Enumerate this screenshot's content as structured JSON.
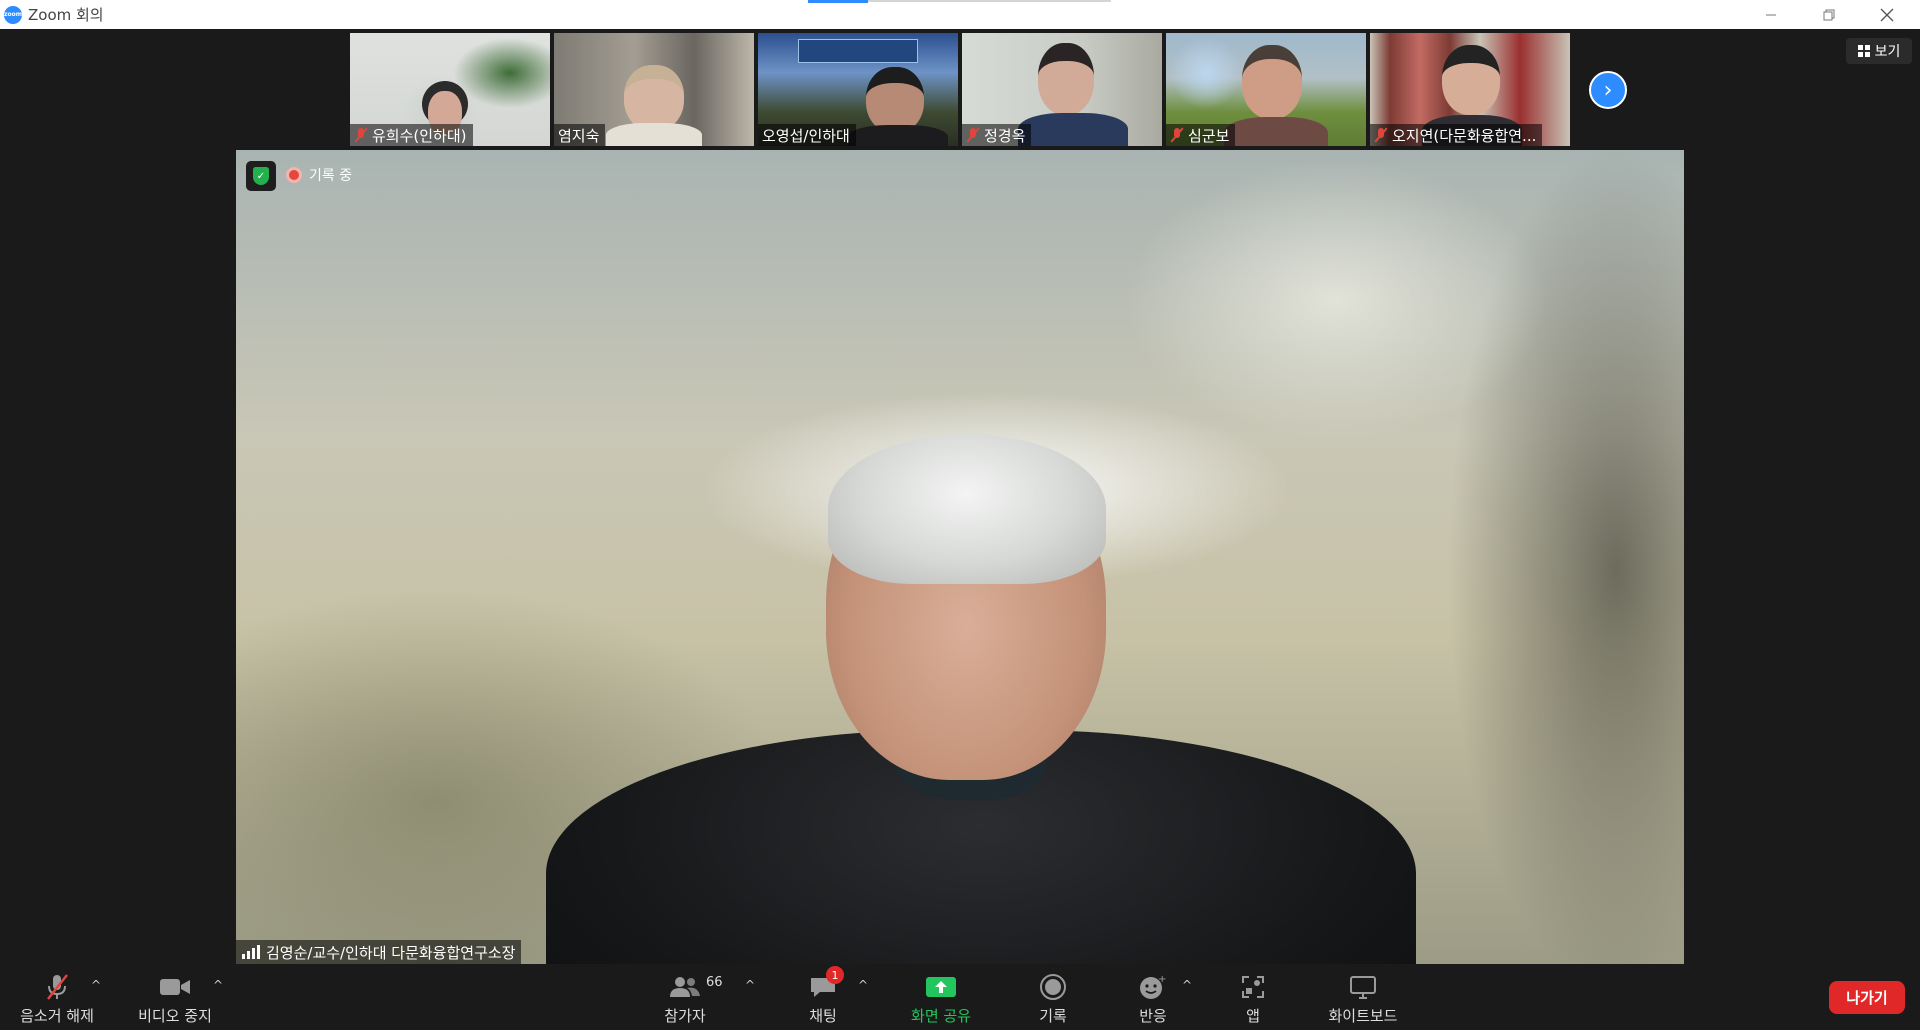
{
  "window": {
    "title": "Zoom 회의",
    "logo_text": "zoom"
  },
  "view_button": {
    "label": "보기"
  },
  "thumbnails": [
    {
      "name": "유희수(인하대)",
      "muted": true
    },
    {
      "name": "염지숙",
      "muted": false
    },
    {
      "name": "오영섭/인하대",
      "muted": false
    },
    {
      "name": "정경옥",
      "muted": true
    },
    {
      "name": "심군보",
      "muted": true
    },
    {
      "name": "오지연(다문화융합연...",
      "muted": true
    }
  ],
  "main": {
    "recording_label": "기록 중",
    "speaker_name": "김영순/교수/인하대 다문화융합연구소장"
  },
  "toolbar": {
    "unmute_label": "음소거 해제",
    "video_label": "비디오 중지",
    "participants_label": "참가자",
    "participants_count": "66",
    "chat_label": "채팅",
    "chat_badge": "1",
    "share_label": "화면 공유",
    "record_label": "기록",
    "reactions_label": "반응",
    "apps_label": "앱",
    "whiteboard_label": "화이트보드",
    "leave_label": "나가기"
  },
  "colors": {
    "accent": "#2d8cff",
    "share_green": "#23c55e",
    "leave_red": "#e02828"
  }
}
